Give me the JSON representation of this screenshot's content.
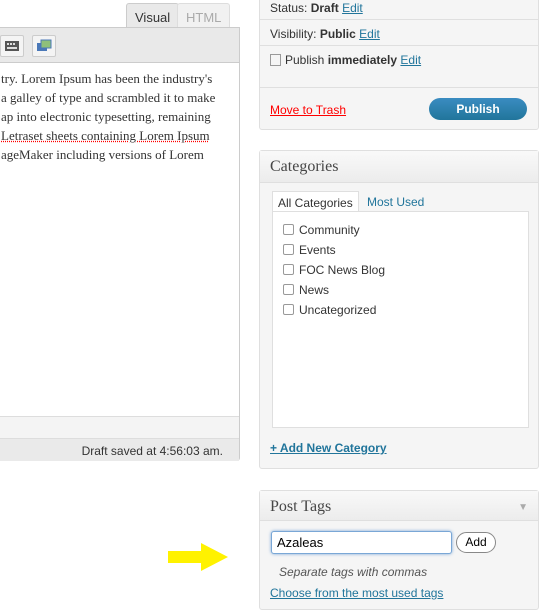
{
  "editor": {
    "tabs": [
      {
        "label": "Visual",
        "active": true
      },
      {
        "label": "HTML",
        "active": false
      }
    ],
    "toolbar_icons": [
      "keyboard-icon",
      "insert-media-icon"
    ],
    "content_lines": [
      "try. Lorem Ipsum has been the industry's",
      "a galley of type and scrambled it to make",
      "ap into electronic typesetting, remaining",
      "Letraset sheets containing Lorem Ipsum",
      "ageMaker including versions of Lorem"
    ],
    "status": "Draft saved at 4:56:03 am."
  },
  "publish": {
    "status_label": "Status:",
    "status_value": "Draft",
    "visibility_label": "Visibility:",
    "visibility_value": "Public",
    "publish_label": "Publish",
    "publish_value": "immediately",
    "edit": "Edit",
    "trash": "Move to Trash",
    "publish_button": "Publish",
    "accent": "#21759b"
  },
  "categories": {
    "title": "Categories",
    "tabs": [
      "All Categories",
      "Most Used"
    ],
    "items": [
      "Community",
      "Events",
      "FOC News Blog",
      "News",
      "Uncategorized"
    ],
    "add_new": "+ Add New Category"
  },
  "tags": {
    "title": "Post Tags",
    "input_value": "Azaleas",
    "add_button": "Add",
    "hint": "Separate tags with commas",
    "choose_link": "Choose from the most used tags"
  },
  "annotation": {
    "arrow_color": "#fff200"
  }
}
